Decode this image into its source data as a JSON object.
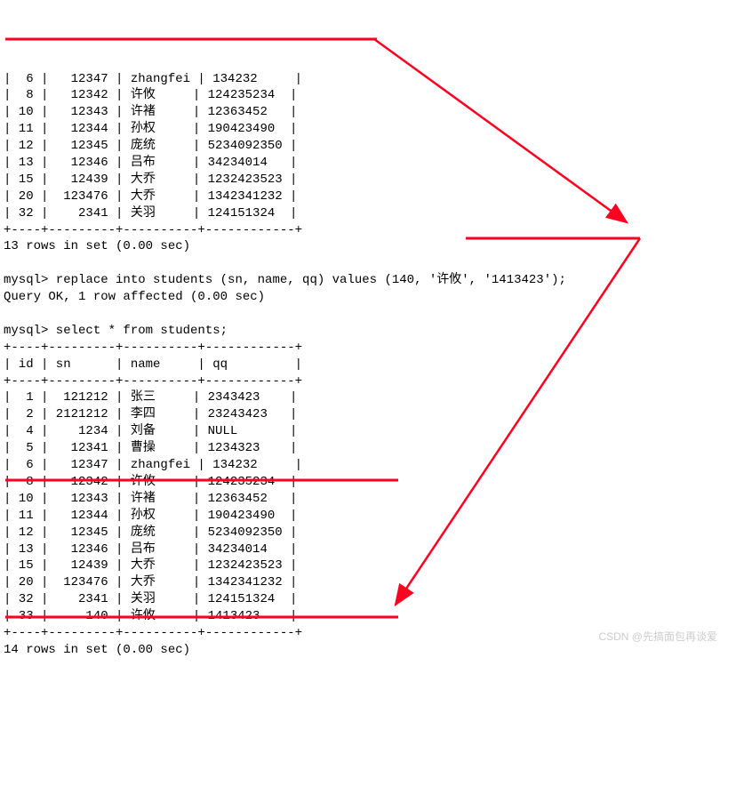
{
  "table1_rows_before_hl": [
    "|  6 |   12347 | zhangfei | 134232     |",
    "|  8 |   12342 | 许攸     | 124235234  |"
  ],
  "table1_rows_after_hl": [
    "| 10 |   12343 | 许褚     | 12363452   |",
    "| 11 |   12344 | 孙权     | 190423490  |",
    "| 12 |   12345 | 庞统     | 5234092350 |",
    "| 13 |   12346 | 吕布     | 34234014   |",
    "| 15 |   12439 | 大乔     | 1232423523 |",
    "| 20 |  123476 | 大乔     | 1342341232 |",
    "| 32 |    2341 | 关羽     | 124151324  |"
  ],
  "table1_footer_border": "+----+---------+----------+------------+",
  "table1_summary": "13 rows in set (0.00 sec)",
  "blank": "",
  "prompt1_prefix": "mysql> replace into students (sn, name, qq) values (",
  "prompt1_values": "140, '许攸', '1413423'",
  "prompt1_suffix": ");",
  "result1": "Query OK, 1 row affected (0.00 sec)",
  "prompt2": "mysql> select * from students;",
  "table2_border": "+----+---------+----------+------------+",
  "table2_header": "| id | sn      | name     | qq         |",
  "table2_rows_before_hl": [
    "|  1 |  121212 | 张三     | 2343423    |",
    "|  2 | 2121212 | 李四     | 23243423   |",
    "|  4 |    1234 | 刘备     | NULL       |",
    "|  5 |   12341 | 曹操     | 1234323    |",
    "|  6 |   12347 | zhangfei | 134232     |",
    "|  8 |   12342 | 许攸     | 124235234  |"
  ],
  "table2_rows_mid": [
    "| 10 |   12343 | 许褚     | 12363452   |",
    "| 11 |   12344 | 孙权     | 190423490  |",
    "| 12 |   12345 | 庞统     | 5234092350 |",
    "| 13 |   12346 | 吕布     | 34234014   |",
    "| 15 |   12439 | 大乔     | 1232423523 |",
    "| 20 |  123476 | 大乔     | 1342341232 |",
    "| 32 |    2341 | 关羽     | 124151324  |",
    "| 33 |     140 | 许攸     | 1413423    |"
  ],
  "table2_summary": "14 rows in set (0.00 sec)",
  "watermark": "CSDN @先搞面包再谈爱"
}
